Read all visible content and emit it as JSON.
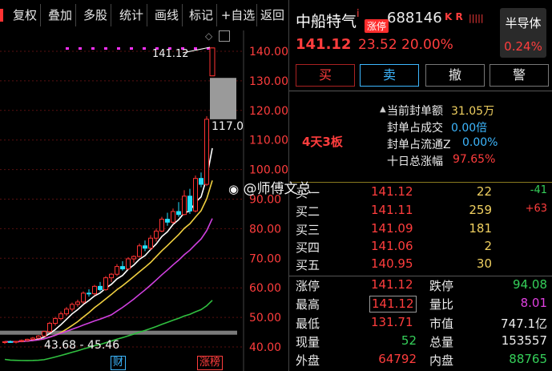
{
  "toolbar": {
    "items": [
      "复权",
      "叠加",
      "多股",
      "统计",
      "画线",
      "标记",
      "+自选",
      "返回"
    ]
  },
  "chart": {
    "price_labels": [
      "140.00",
      "130.00",
      "120.00",
      "110.00",
      "100.00",
      "90.00",
      "80.00",
      "70.00",
      "60.00",
      "50.00",
      "40.00"
    ],
    "last_price_label": "141.12",
    "tooltip_price": "117.0",
    "range_label": "43.68 - 45.46",
    "bottom_tags": [
      "财",
      "涨榜"
    ],
    "colors": {
      "up": "#ff3333",
      "down": "#25e0ff",
      "ma5": "#ffffff",
      "ma10": "#f0d040",
      "ma20": "#d040e0",
      "ma60": "#30c040",
      "grid": "#3a0a0a",
      "axis_text": "#ff3d3d"
    }
  },
  "stock": {
    "name": "中船特气",
    "tag_i": "i",
    "code": "688146",
    "krx_tag": "K R",
    "limit_tag": "涨停",
    "price": "141.12",
    "change": "23.52",
    "change_pct": "20.00%",
    "sector": {
      "name": "半导体",
      "pct": "0.24%"
    }
  },
  "actions": {
    "buy": "买",
    "sell": "卖",
    "cancel": "撤",
    "alert": "警"
  },
  "seal": {
    "streak": "4天3板",
    "rows": [
      {
        "label": "当前封单额",
        "value": "31.05万"
      },
      {
        "label": "封单占成交",
        "value": "0.00倍"
      },
      {
        "label": "封单占流通Z",
        "value": "0.00%"
      },
      {
        "label": "十日总涨幅",
        "value": "97.65%"
      }
    ]
  },
  "watermark": "@师傅文总",
  "orderbook": [
    {
      "label": "买一",
      "price": "141.12",
      "vol": "22",
      "delta": "-41"
    },
    {
      "label": "买二",
      "price": "141.11",
      "vol": "259",
      "delta": "+63"
    },
    {
      "label": "买三",
      "price": "141.09",
      "vol": "181",
      "delta": ""
    },
    {
      "label": "买四",
      "price": "141.06",
      "vol": "2",
      "delta": ""
    },
    {
      "label": "买五",
      "price": "140.95",
      "vol": "30",
      "delta": ""
    }
  ],
  "fundamentals": [
    {
      "l1": "涨停",
      "v1": "141.12",
      "l2": "跌停",
      "v2": "94.08"
    },
    {
      "l1": "最高",
      "v1": "141.12",
      "l2": "量比",
      "v2": "8.01"
    },
    {
      "l1": "最低",
      "v1": "131.71",
      "l2": "市值",
      "v2": "747.1亿"
    },
    {
      "l1": "现量",
      "v1": "52",
      "l2": "总量",
      "v2": "153557"
    },
    {
      "l1": "外盘",
      "v1": "64792",
      "l2": "内盘",
      "v2": "88765"
    }
  ]
}
